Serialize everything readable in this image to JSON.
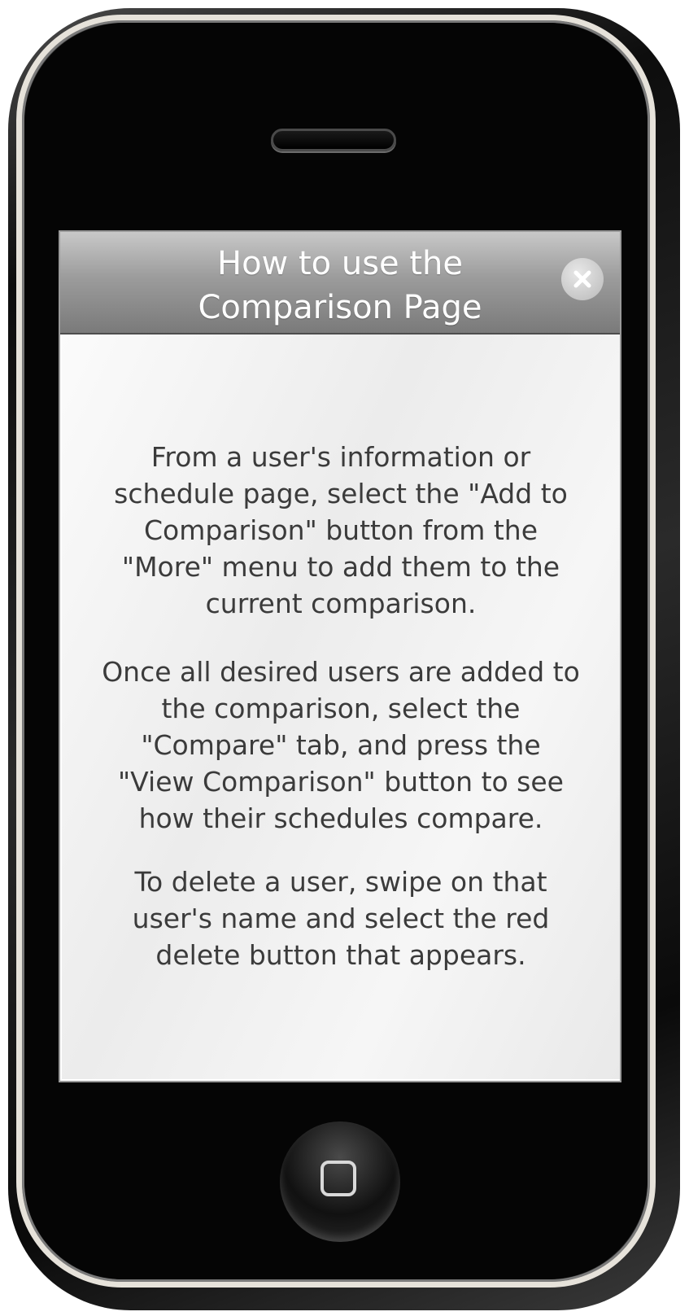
{
  "header": {
    "title_line1": "How to use the",
    "title_line2": "Comparison Page",
    "close_icon": "close-icon"
  },
  "content": {
    "paragraph1": [
      "From a user's information or",
      "schedule page, select the \"Add to",
      "Comparison\" button from the",
      "\"More\" menu to add them to the",
      "current comparison."
    ],
    "paragraph2": [
      "Once all desired users are added to",
      "the comparison, select the",
      "\"Compare\" tab, and press the",
      "\"View Comparison\" button to see",
      "how their schedules compare."
    ],
    "paragraph3": [
      "To delete a user, swipe on that",
      "user's name and select the red",
      "delete button that appears."
    ]
  },
  "device": {
    "home_icon": "home-button-icon",
    "speaker": "earpiece-speaker"
  },
  "colors": {
    "header_top": "#c8c8c8",
    "header_bottom": "#7a7a7a",
    "text": "#3b3b3b"
  }
}
